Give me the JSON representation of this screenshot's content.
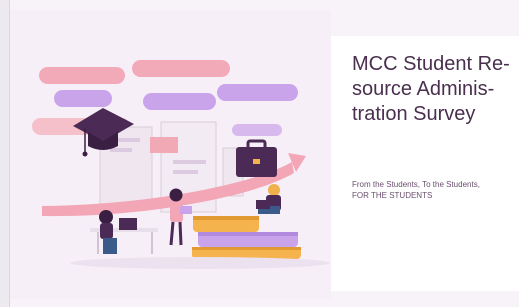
{
  "slide": {
    "title_lines": [
      "MCC Student Re-",
      "source Adminis-",
      "tration Survey"
    ],
    "subtitle_lines": [
      "From the Students, To the Students,",
      "FOR THE STUDENTS"
    ]
  },
  "colors": {
    "background": "#f7f3f8",
    "panel": "#ffffff",
    "title_text": "#4a2f4f",
    "accent_pink": "#f2a7b4",
    "accent_purple": "#c9a4ea",
    "graduation_cap": "#4b2a55",
    "book_yellow": "#f4b34c"
  },
  "icons": [
    "graduation-cap-icon",
    "briefcase-icon",
    "arrow-icon",
    "laptop-icon"
  ]
}
